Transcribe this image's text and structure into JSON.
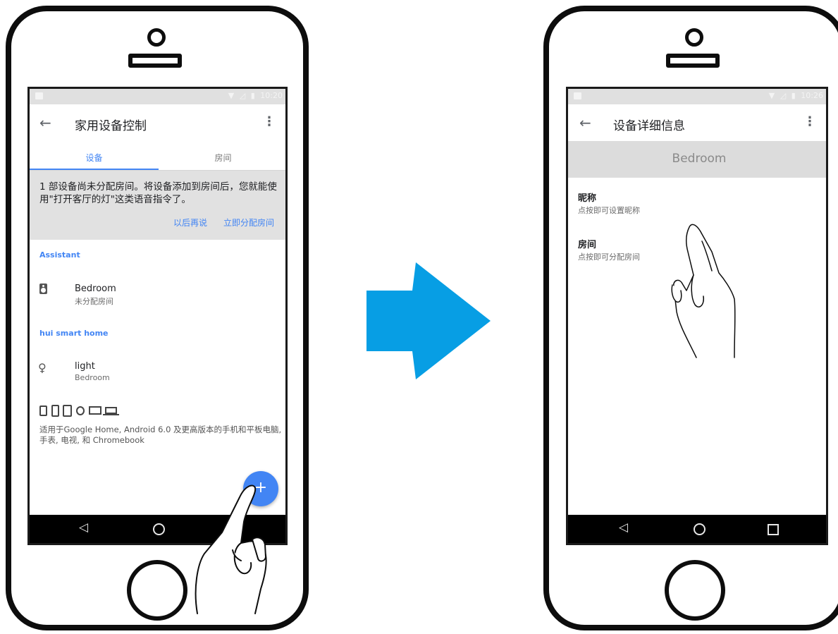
{
  "left_phone": {
    "status_time": "10:20",
    "back_glyph": "←",
    "title": "家用设备控制",
    "tabs": [
      "设备",
      "房间"
    ],
    "banner": {
      "message": "1 部设备尚未分配房间。将设备添加到房间后，您就能使用\"打开客厅的灯\"这类语音指令了。",
      "later": "以后再说",
      "assign_now": "立即分配房间"
    },
    "sections": [
      {
        "header": "Assistant",
        "item_title": "Bedroom",
        "item_subtitle": "未分配房间",
        "icon": "speaker-icon"
      },
      {
        "header": "hui smart home",
        "item_title": "light",
        "item_subtitle": "Bedroom",
        "icon": "lightbulb-icon"
      }
    ],
    "compatibility_text": "适用于Google Home, Android 6.0 及更高版本的手机和平板电脑, 手表, 电视, 和 Chromebook",
    "fab_glyph": "+"
  },
  "right_phone": {
    "status_time": "10:26",
    "back_glyph": "←",
    "title": "设备详细信息",
    "device_name": "Bedroom",
    "fields": [
      {
        "label": "昵称",
        "hint": "点按即可设置昵称"
      },
      {
        "label": "房间",
        "hint": "点按即可分配房间"
      }
    ]
  },
  "colors": {
    "accent": "#4285f4",
    "arrow": "#079ee4",
    "banner_bg": "#e1e1e1",
    "navbar": "#000000"
  }
}
